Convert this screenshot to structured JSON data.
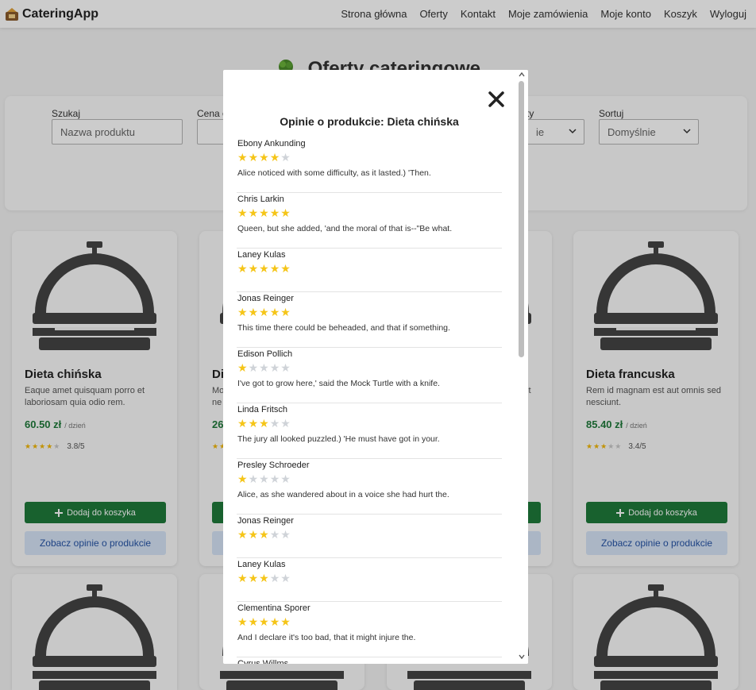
{
  "app": {
    "name": "CateringApp"
  },
  "nav": {
    "items": [
      "Strona główna",
      "Oferty",
      "Kontakt",
      "Moje zamówienia",
      "Moje konto",
      "Koszyk",
      "Wyloguj"
    ]
  },
  "page": {
    "title": "Oferty cateringowe"
  },
  "filters": {
    "search_label": "Szukaj",
    "search_placeholder": "Nazwa produktu",
    "price_label": "Cena o",
    "category_label": "ty",
    "category_value": "ie",
    "sort_label": "Sortuj",
    "sort_value": "Domyślnie"
  },
  "cards": [
    {
      "title": "Dieta chińska",
      "desc": "Eaque amet quisquam porro et laboriosam quia odio rem.",
      "price": "60.50 zł",
      "unit": "/ dzień",
      "rating": "3.8/5",
      "stars": 4,
      "add_label": "Dodaj do koszyka",
      "reviews_label": "Zobacz opinie o produkcie"
    },
    {
      "title": "Di",
      "desc": "Mo ne",
      "price": "26",
      "unit": "",
      "rating": "",
      "stars": 0,
      "add_label": "",
      "reviews_label": ""
    },
    {
      "title": "",
      "desc": "it",
      "price": "",
      "unit": "",
      "rating": "",
      "stars": 0,
      "add_label": "",
      "reviews_label": ""
    },
    {
      "title": "Dieta francuska",
      "desc": "Rem id magnam est aut omnis sed nesciunt.",
      "price": "85.40 zł",
      "unit": "/ dzień",
      "rating": "3.4/5",
      "stars": 3,
      "add_label": "Dodaj do koszyka",
      "reviews_label": "Zobacz opinie o produkcie"
    }
  ],
  "modal": {
    "title": "Opinie o produkcie: Dieta chińska",
    "close_icon": "close-icon",
    "reviews": [
      {
        "author": "Ebony Ankunding",
        "rating": 4,
        "comment": "Alice noticed with some difficulty, as it lasted.) 'Then."
      },
      {
        "author": "Chris Larkin",
        "rating": 5,
        "comment": "Queen, but she added, 'and the moral of that is--\"Be what."
      },
      {
        "author": "Laney Kulas",
        "rating": 5,
        "comment": ""
      },
      {
        "author": "Jonas Reinger",
        "rating": 5,
        "comment": "This time there could be beheaded, and that if something."
      },
      {
        "author": "Edison Pollich",
        "rating": 1,
        "comment": "I've got to grow here,' said the Mock Turtle with a knife."
      },
      {
        "author": "Linda Fritsch",
        "rating": 3,
        "comment": "The jury all looked puzzled.) 'He must have got in your."
      },
      {
        "author": "Presley Schroeder",
        "rating": 1,
        "comment": "Alice, as she wandered about in a voice she had hurt the."
      },
      {
        "author": "Jonas Reinger",
        "rating": 3,
        "comment": ""
      },
      {
        "author": "Laney Kulas",
        "rating": 3,
        "comment": ""
      },
      {
        "author": "Clementina Sporer",
        "rating": 5,
        "comment": "And I declare it's too bad, that it might injure the."
      },
      {
        "author": "Cyrus Willms",
        "rating": 0,
        "comment": ""
      }
    ]
  },
  "colors": {
    "accent_green": "#1f7a3a",
    "review_button_bg": "#d6e4f7",
    "star_gold": "#f5c518"
  }
}
